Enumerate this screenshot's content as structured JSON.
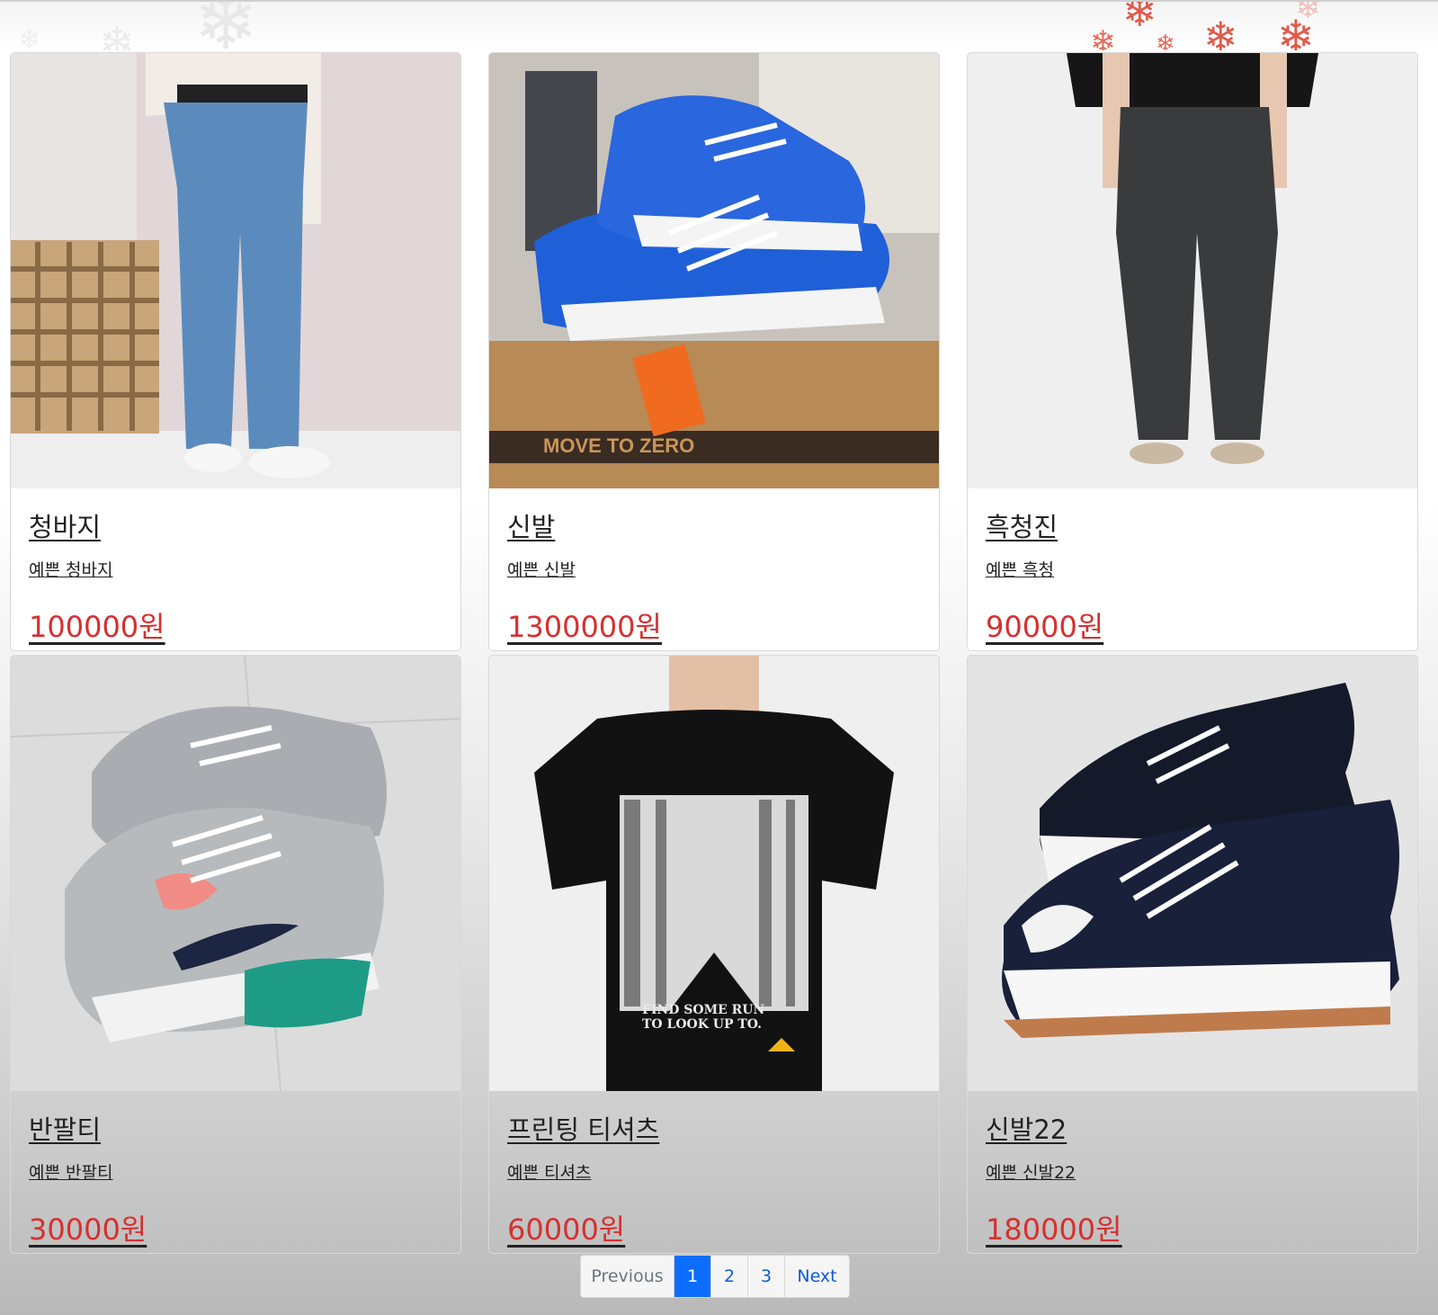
{
  "products": [
    {
      "name": "청바지",
      "desc": "예쁜 청바지",
      "price": "100000원",
      "image": "blue-jeans-photo"
    },
    {
      "name": "신발",
      "desc": "예쁜 신발",
      "price": "1300000원",
      "image": "blue-sneakers-photo"
    },
    {
      "name": "흑청진",
      "desc": "예쁜 흑청",
      "price": "90000원",
      "image": "black-jeans-photo"
    },
    {
      "name": "반팔티",
      "desc": "예쁜 반팔티",
      "price": "30000원",
      "image": "grey-sneakers-photo"
    },
    {
      "name": "프린팅 티셔츠",
      "desc": "예쁜 티셔츠",
      "price": "60000원",
      "image": "printed-tshirt-photo"
    },
    {
      "name": "신발22",
      "desc": "예쁜 신발22",
      "price": "180000원",
      "image": "black-hightops-photo"
    }
  ],
  "pagination": {
    "previous": "Previous",
    "pages": [
      "1",
      "2",
      "3"
    ],
    "active": "1",
    "next": "Next"
  },
  "colors": {
    "price": "#d63030",
    "active_page": "#0d6efd",
    "link": "#0d5bd6"
  },
  "decoration": {
    "icon": "snowflake-icon"
  }
}
